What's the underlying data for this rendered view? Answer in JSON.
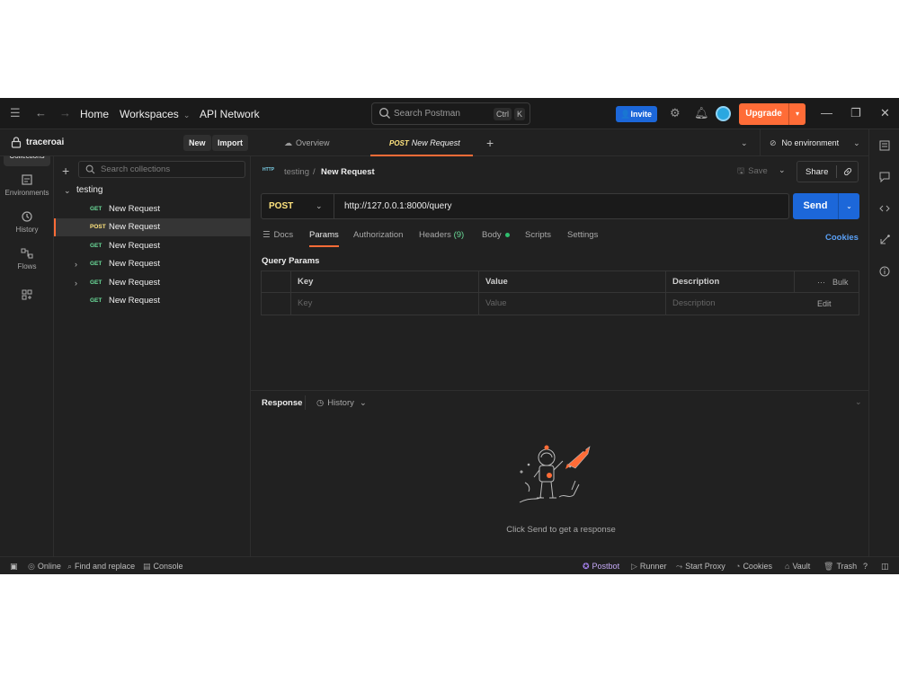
{
  "titlebar": {
    "nav_home": "Home",
    "nav_workspaces": "Workspaces",
    "nav_api_network": "API Network",
    "search_placeholder": "Search Postman",
    "search_kbd_ctrl": "Ctrl",
    "search_kbd_k": "K",
    "invite_label": "Invite",
    "upgrade_label": "Upgrade"
  },
  "workspace": {
    "name": "traceroai",
    "new_label": "New",
    "import_label": "Import"
  },
  "rail": {
    "items": [
      {
        "label": "Collections",
        "icon": "collections-icon"
      },
      {
        "label": "Environments",
        "icon": "environments-icon"
      },
      {
        "label": "History",
        "icon": "history-icon"
      },
      {
        "label": "Flows",
        "icon": "flows-icon"
      }
    ]
  },
  "sidebar": {
    "search_placeholder": "Search collections",
    "collection_name": "testing",
    "requests": [
      {
        "method": "GET",
        "name": "New Request",
        "expandable": false
      },
      {
        "method": "POST",
        "name": "New Request",
        "expandable": false,
        "selected": true
      },
      {
        "method": "GET",
        "name": "New Request",
        "expandable": false
      },
      {
        "method": "GET",
        "name": "New Request",
        "expandable": true
      },
      {
        "method": "GET",
        "name": "New Request",
        "expandable": true
      },
      {
        "method": "GET",
        "name": "New Request",
        "expandable": false
      }
    ]
  },
  "tabs": {
    "overview_label": "Overview",
    "active_method": "POST",
    "active_name": "New Request",
    "environment": "No environment"
  },
  "request": {
    "breadcrumb_parent": "testing",
    "breadcrumb_sep": "/",
    "breadcrumb_current": "New Request",
    "http_badge": "HTTP",
    "save_label": "Save",
    "share_label": "Share",
    "method": "POST",
    "url": "http://127.0.0.1:8000/query",
    "send_label": "Send",
    "subtabs": {
      "docs": "Docs",
      "params": "Params",
      "authorization": "Authorization",
      "headers": "Headers",
      "headers_count": "(9)",
      "body": "Body",
      "scripts": "Scripts",
      "settings": "Settings"
    },
    "cookies_label": "Cookies",
    "query_params_label": "Query Params",
    "table": {
      "headers": [
        "Key",
        "Value",
        "Description"
      ],
      "placeholders": [
        "Key",
        "Value",
        "Description"
      ],
      "bulk_edit": "Bulk Edit"
    }
  },
  "response": {
    "title": "Response",
    "history_label": "History",
    "empty_message": "Click Send to get a response"
  },
  "statusbar": {
    "online": "Online",
    "find_replace": "Find and replace",
    "console": "Console",
    "postbot": "Postbot",
    "runner": "Runner",
    "start_proxy": "Start Proxy",
    "cookies": "Cookies",
    "vault": "Vault",
    "trash": "Trash"
  },
  "colors": {
    "accent_orange": "#ff6c37",
    "primary_blue": "#1c67d9",
    "get_green": "#6bdd9a",
    "post_yellow": "#ffe47e",
    "background": "#212121"
  }
}
